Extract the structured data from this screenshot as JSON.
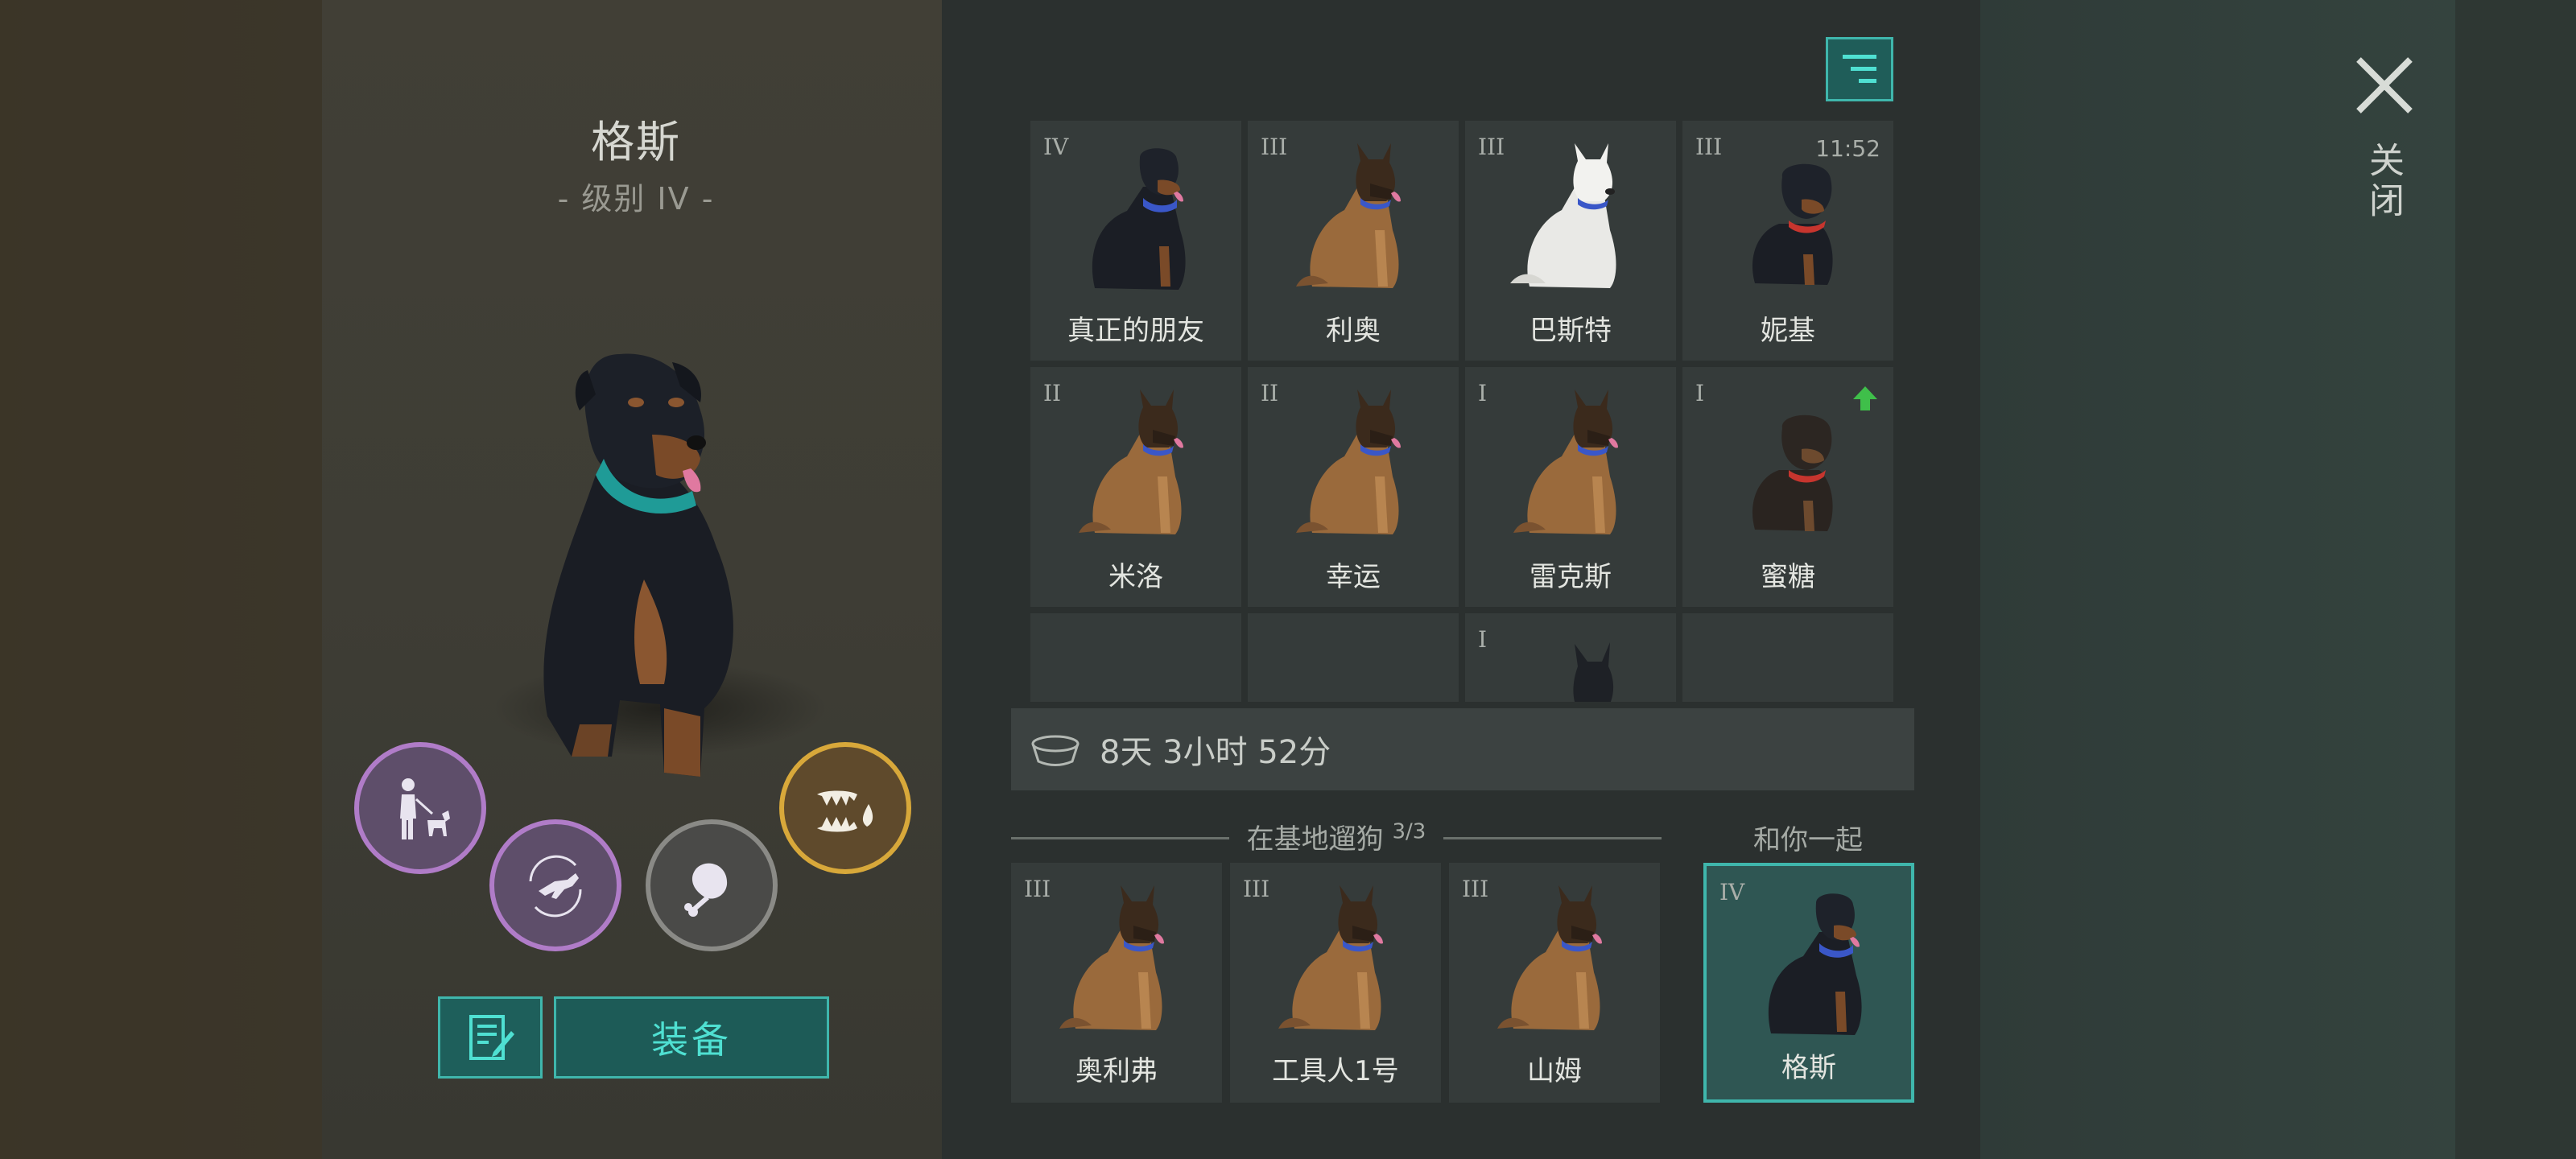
{
  "selected_dog": {
    "name": "格斯",
    "level": "- 级别 IV -"
  },
  "actions": {
    "equip_label": "装备"
  },
  "skills": [
    {
      "icon": "walk-dog-icon",
      "ring": "purple"
    },
    {
      "icon": "dog-jump-icon",
      "ring": "purple"
    },
    {
      "icon": "meat-icon",
      "ring": "grey"
    },
    {
      "icon": "fang-venom-icon",
      "ring": "gold"
    }
  ],
  "dogs": [
    {
      "rank": "IV",
      "name": "真正的朋友",
      "breed": "rottweiler",
      "timer": ""
    },
    {
      "rank": "III",
      "name": "利奥",
      "breed": "shepherd",
      "timer": ""
    },
    {
      "rank": "III",
      "name": "巴斯特",
      "breed": "white-shepherd",
      "timer": ""
    },
    {
      "rank": "III",
      "name": "妮基",
      "breed": "rottweiler-puppy",
      "timer": "11:52"
    },
    {
      "rank": "II",
      "name": "米洛",
      "breed": "shepherd",
      "timer": ""
    },
    {
      "rank": "II",
      "name": "幸运",
      "breed": "shepherd",
      "timer": ""
    },
    {
      "rank": "I",
      "name": "雷克斯",
      "breed": "shepherd",
      "timer": ""
    },
    {
      "rank": "I",
      "name": "蜜糖",
      "breed": "puppy",
      "timer": "",
      "upgrade": true
    },
    {
      "rank": "",
      "name": "",
      "breed": "",
      "timer": ""
    },
    {
      "rank": "",
      "name": "",
      "breed": "",
      "timer": ""
    },
    {
      "rank": "I",
      "name": "",
      "breed": "black-dog",
      "timer": ""
    },
    {
      "rank": "",
      "name": "",
      "breed": "",
      "timer": ""
    }
  ],
  "food_timer": "8天 3小时 52分",
  "walking": {
    "label": "在基地遛狗",
    "count": "3/3",
    "dogs": [
      {
        "rank": "III",
        "name": "奥利弗"
      },
      {
        "rank": "III",
        "name": "工具人1号"
      },
      {
        "rank": "III",
        "name": "山姆"
      }
    ]
  },
  "with_you": {
    "label": "和你一起",
    "dog": {
      "rank": "IV",
      "name": "格斯"
    }
  },
  "close_label": "关闭",
  "colors": {
    "accent": "#3fb6ac",
    "accent_text": "#4fe0d2",
    "upgrade": "#3fbf4a"
  }
}
